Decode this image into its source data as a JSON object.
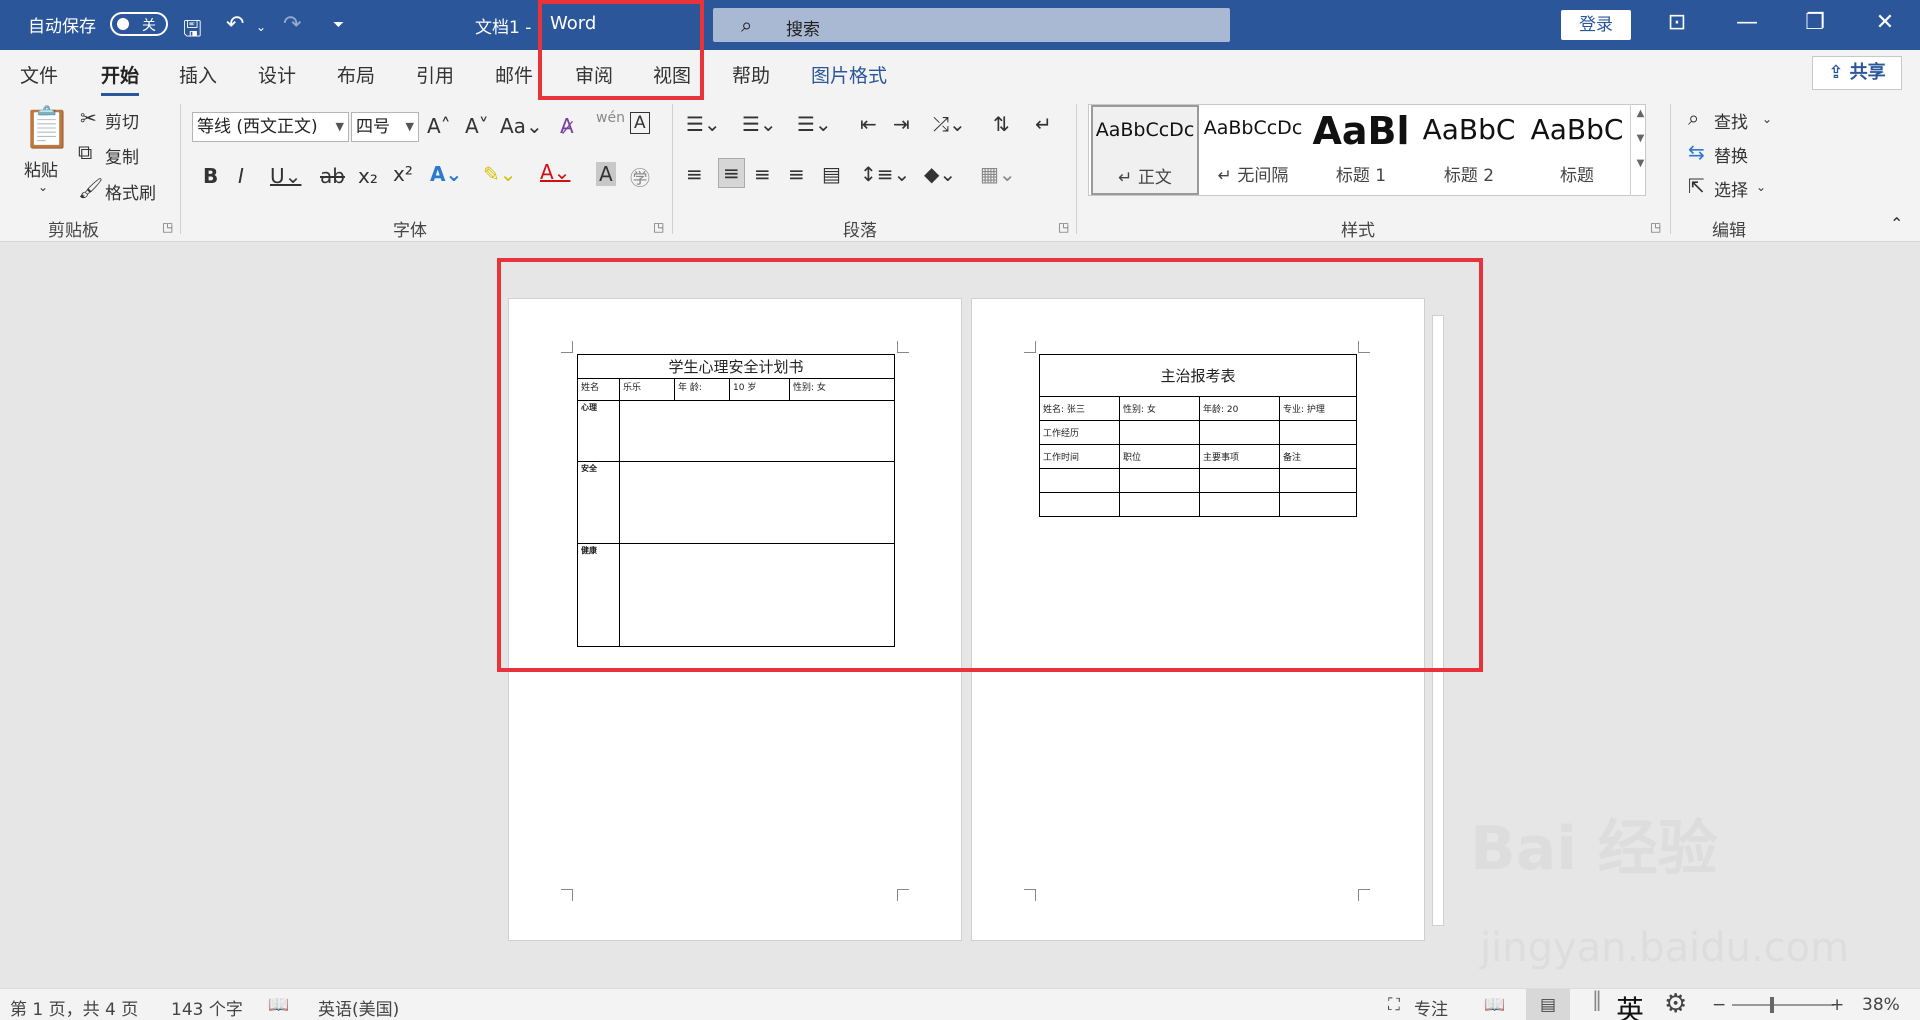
{
  "titlebar": {
    "autosave_label": "自动保存",
    "autosave_state": "关",
    "doc_title": "文档1  -",
    "app_name": "Word",
    "search_placeholder": "搜索",
    "login_label": "登录"
  },
  "tabs": [
    "文件",
    "开始",
    "插入",
    "设计",
    "布局",
    "引用",
    "邮件",
    "审阅",
    "视图",
    "帮助",
    "图片格式"
  ],
  "active_tab": "开始",
  "share_label": "共享",
  "ribbon": {
    "clipboard": {
      "paste": "粘贴",
      "cut": "剪切",
      "copy": "复制",
      "format_painter": "格式刷",
      "label": "剪贴板"
    },
    "font": {
      "font_name": "等线 (西文正文)",
      "font_size": "四号",
      "label": "字体"
    },
    "paragraph": {
      "label": "段落"
    },
    "styles": {
      "label": "样式",
      "items": [
        {
          "preview": "AaBbCcDc",
          "name": "↵ 正文"
        },
        {
          "preview": "AaBbCcDc",
          "name": "↵ 无间隔"
        },
        {
          "preview": "AaBl",
          "name": "标题 1"
        },
        {
          "preview": "AaBbC",
          "name": "标题 2"
        },
        {
          "preview": "AaBbC",
          "name": "标题"
        }
      ]
    },
    "editing": {
      "find": "查找",
      "replace": "替换",
      "select": "选择",
      "label": "编辑"
    }
  },
  "page1": {
    "title": "学生心理安全计划书",
    "row1": [
      "姓名",
      "乐乐",
      "年  龄:",
      "10 岁",
      "性别: 女"
    ],
    "sections": [
      "心理",
      "安全",
      "健康"
    ]
  },
  "page2": {
    "title": "主治报考表",
    "row1": [
      "姓名: 张三",
      "性别: 女",
      "年龄: 20",
      "专业: 护理"
    ],
    "row2": [
      "工作经历",
      "",
      "",
      ""
    ],
    "row3": [
      "工作时间",
      "职位",
      "主要事项",
      "备注"
    ]
  },
  "status": {
    "page_info": "第 1 页，共 4 页",
    "word_count": "143 个字",
    "language": "英语(美国)",
    "focus": "专注",
    "ime": "英",
    "zoom": "38%"
  },
  "watermark": {
    "brand": "Bai 经验",
    "url": "jingyan.baidu.com"
  },
  "colors": {
    "title_bar": "#2b579a",
    "highlight": "#e8333a"
  }
}
